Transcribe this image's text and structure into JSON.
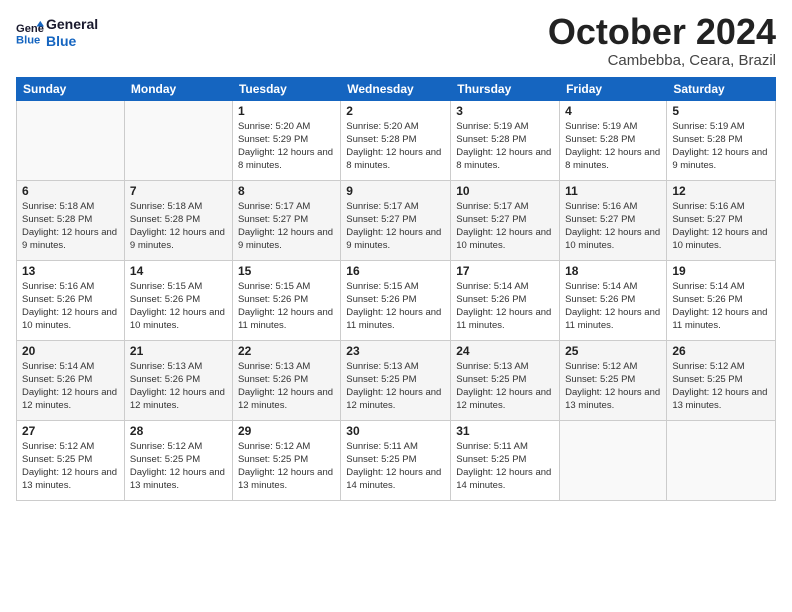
{
  "logo": {
    "line1": "General",
    "line2": "Blue"
  },
  "title": "October 2024",
  "subtitle": "Cambebba, Ceara, Brazil",
  "days_of_week": [
    "Sunday",
    "Monday",
    "Tuesday",
    "Wednesday",
    "Thursday",
    "Friday",
    "Saturday"
  ],
  "weeks": [
    [
      {
        "day": "",
        "info": ""
      },
      {
        "day": "",
        "info": ""
      },
      {
        "day": "1",
        "info": "Sunrise: 5:20 AM\nSunset: 5:29 PM\nDaylight: 12 hours and 8 minutes."
      },
      {
        "day": "2",
        "info": "Sunrise: 5:20 AM\nSunset: 5:28 PM\nDaylight: 12 hours and 8 minutes."
      },
      {
        "day": "3",
        "info": "Sunrise: 5:19 AM\nSunset: 5:28 PM\nDaylight: 12 hours and 8 minutes."
      },
      {
        "day": "4",
        "info": "Sunrise: 5:19 AM\nSunset: 5:28 PM\nDaylight: 12 hours and 8 minutes."
      },
      {
        "day": "5",
        "info": "Sunrise: 5:19 AM\nSunset: 5:28 PM\nDaylight: 12 hours and 9 minutes."
      }
    ],
    [
      {
        "day": "6",
        "info": "Sunrise: 5:18 AM\nSunset: 5:28 PM\nDaylight: 12 hours and 9 minutes."
      },
      {
        "day": "7",
        "info": "Sunrise: 5:18 AM\nSunset: 5:28 PM\nDaylight: 12 hours and 9 minutes."
      },
      {
        "day": "8",
        "info": "Sunrise: 5:17 AM\nSunset: 5:27 PM\nDaylight: 12 hours and 9 minutes."
      },
      {
        "day": "9",
        "info": "Sunrise: 5:17 AM\nSunset: 5:27 PM\nDaylight: 12 hours and 9 minutes."
      },
      {
        "day": "10",
        "info": "Sunrise: 5:17 AM\nSunset: 5:27 PM\nDaylight: 12 hours and 10 minutes."
      },
      {
        "day": "11",
        "info": "Sunrise: 5:16 AM\nSunset: 5:27 PM\nDaylight: 12 hours and 10 minutes."
      },
      {
        "day": "12",
        "info": "Sunrise: 5:16 AM\nSunset: 5:27 PM\nDaylight: 12 hours and 10 minutes."
      }
    ],
    [
      {
        "day": "13",
        "info": "Sunrise: 5:16 AM\nSunset: 5:26 PM\nDaylight: 12 hours and 10 minutes."
      },
      {
        "day": "14",
        "info": "Sunrise: 5:15 AM\nSunset: 5:26 PM\nDaylight: 12 hours and 10 minutes."
      },
      {
        "day": "15",
        "info": "Sunrise: 5:15 AM\nSunset: 5:26 PM\nDaylight: 12 hours and 11 minutes."
      },
      {
        "day": "16",
        "info": "Sunrise: 5:15 AM\nSunset: 5:26 PM\nDaylight: 12 hours and 11 minutes."
      },
      {
        "day": "17",
        "info": "Sunrise: 5:14 AM\nSunset: 5:26 PM\nDaylight: 12 hours and 11 minutes."
      },
      {
        "day": "18",
        "info": "Sunrise: 5:14 AM\nSunset: 5:26 PM\nDaylight: 12 hours and 11 minutes."
      },
      {
        "day": "19",
        "info": "Sunrise: 5:14 AM\nSunset: 5:26 PM\nDaylight: 12 hours and 11 minutes."
      }
    ],
    [
      {
        "day": "20",
        "info": "Sunrise: 5:14 AM\nSunset: 5:26 PM\nDaylight: 12 hours and 12 minutes."
      },
      {
        "day": "21",
        "info": "Sunrise: 5:13 AM\nSunset: 5:26 PM\nDaylight: 12 hours and 12 minutes."
      },
      {
        "day": "22",
        "info": "Sunrise: 5:13 AM\nSunset: 5:26 PM\nDaylight: 12 hours and 12 minutes."
      },
      {
        "day": "23",
        "info": "Sunrise: 5:13 AM\nSunset: 5:25 PM\nDaylight: 12 hours and 12 minutes."
      },
      {
        "day": "24",
        "info": "Sunrise: 5:13 AM\nSunset: 5:25 PM\nDaylight: 12 hours and 12 minutes."
      },
      {
        "day": "25",
        "info": "Sunrise: 5:12 AM\nSunset: 5:25 PM\nDaylight: 12 hours and 13 minutes."
      },
      {
        "day": "26",
        "info": "Sunrise: 5:12 AM\nSunset: 5:25 PM\nDaylight: 12 hours and 13 minutes."
      }
    ],
    [
      {
        "day": "27",
        "info": "Sunrise: 5:12 AM\nSunset: 5:25 PM\nDaylight: 12 hours and 13 minutes."
      },
      {
        "day": "28",
        "info": "Sunrise: 5:12 AM\nSunset: 5:25 PM\nDaylight: 12 hours and 13 minutes."
      },
      {
        "day": "29",
        "info": "Sunrise: 5:12 AM\nSunset: 5:25 PM\nDaylight: 12 hours and 13 minutes."
      },
      {
        "day": "30",
        "info": "Sunrise: 5:11 AM\nSunset: 5:25 PM\nDaylight: 12 hours and 14 minutes."
      },
      {
        "day": "31",
        "info": "Sunrise: 5:11 AM\nSunset: 5:25 PM\nDaylight: 12 hours and 14 minutes."
      },
      {
        "day": "",
        "info": ""
      },
      {
        "day": "",
        "info": ""
      }
    ]
  ]
}
